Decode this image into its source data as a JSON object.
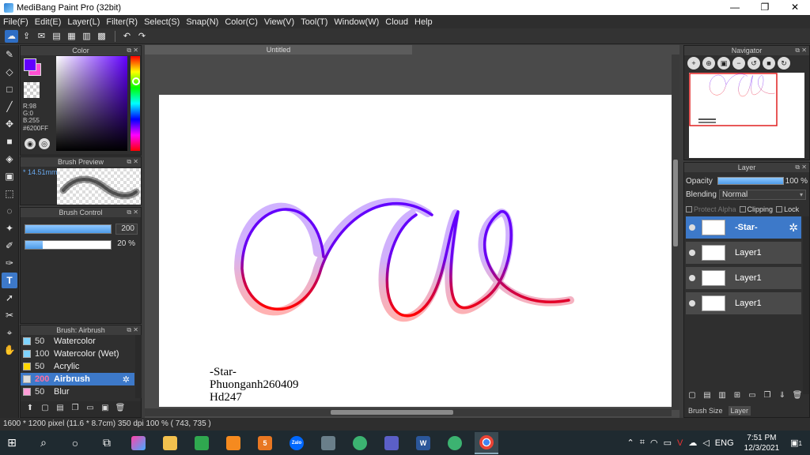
{
  "window": {
    "title": "MediBang Paint Pro (32bit)",
    "min": "—",
    "max": "❐",
    "close": "✕"
  },
  "menu": [
    "File(F)",
    "Edit(E)",
    "Layer(L)",
    "Filter(R)",
    "Select(S)",
    "Snap(N)",
    "Color(C)",
    "View(V)",
    "Tool(T)",
    "Window(W)",
    "Cloud",
    "Help"
  ],
  "color_panel": {
    "title": "Color",
    "r": "R:98",
    "g": "G:0",
    "b": "B:255",
    "hex": "#6200FF",
    "fg_color": "#6200ff",
    "bg_color": "#ff4fd3"
  },
  "brush_preview": {
    "title": "Brush Preview",
    "size": "* 14.51mm"
  },
  "brush_control": {
    "title": "Brush Control",
    "size_value": "200",
    "size_fraction": 1.0,
    "opacity_value": "20 %",
    "opacity_fraction": 0.2
  },
  "brush_list": {
    "title": "Brush: Airbrush",
    "items": [
      {
        "size": "50",
        "name": "Watercolor",
        "color": "#7fd4ff"
      },
      {
        "size": "100",
        "name": "Watercolor (Wet)",
        "color": "#7fd4ff"
      },
      {
        "size": "50",
        "name": "Acrylic",
        "color": "#ffd700"
      },
      {
        "size": "200",
        "name": "Airbrush",
        "color": "#dddddd"
      },
      {
        "size": "50",
        "name": "Blur",
        "color": "#ff9ed8"
      }
    ],
    "selected_index": 3
  },
  "canvas": {
    "tab": "Untitled",
    "signature": [
      "-Star-",
      "Phuonganh260409",
      "Hd247"
    ]
  },
  "navigator": {
    "title": "Navigator"
  },
  "layer_panel": {
    "title": "Layer",
    "opacity_label": "Opacity",
    "opacity_value": "100 %",
    "blending_label": "Blending",
    "blending_value": "Normal",
    "protect_alpha": "Protect Alpha",
    "clipping": "Clipping",
    "lock": "Lock",
    "layers": [
      {
        "name": "-Star-",
        "selected": true
      },
      {
        "name": "Layer1",
        "selected": false
      },
      {
        "name": "Layer1",
        "selected": false
      },
      {
        "name": "Layer1",
        "selected": false
      }
    ],
    "tab_brush_size": "Brush Size",
    "tab_layer": "Layer"
  },
  "status": "1600 * 1200 pixel   (11.6 * 8.7cm)   350 dpi   100 %   ( 743, 735 )",
  "taskbar": {
    "lang": "ENG",
    "time": "7:51 PM",
    "date": "12/3/2021",
    "notifications": "1",
    "zalo": "Zalo",
    "word": "W"
  },
  "colors": {
    "accent": "#3d79c9",
    "stroke_top": "#6200ff",
    "stroke_bottom": "#ff0000"
  }
}
